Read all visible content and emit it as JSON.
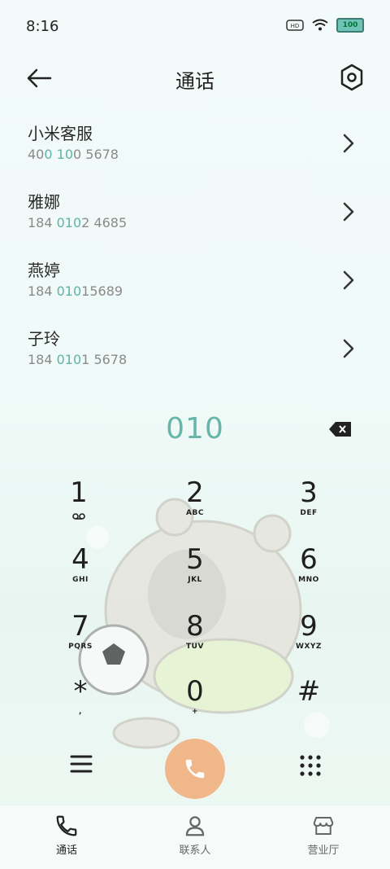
{
  "status": {
    "time": "8:16",
    "battery": "100"
  },
  "header": {
    "title": "通话"
  },
  "contacts": [
    {
      "name": "小米客服",
      "num_a": "40",
      "num_b": "0",
      "num_c": " ",
      "num_d": "10",
      "num_e": "0 5678"
    },
    {
      "name": "雅娜",
      "num_a": "184 ",
      "num_b": "010",
      "num_c": "",
      "num_d": "",
      "num_e": "2 4685"
    },
    {
      "name": "燕婷",
      "num_a": "184 ",
      "num_b": "010",
      "num_c": "",
      "num_d": "",
      "num_e": "15689"
    },
    {
      "name": "子玲",
      "num_a": "184 ",
      "num_b": "010",
      "num_c": "",
      "num_d": "",
      "num_e": "1 5678"
    }
  ],
  "dialer": {
    "input": "010"
  },
  "keys": [
    {
      "digit": "1",
      "letters": ""
    },
    {
      "digit": "2",
      "letters": "ABC"
    },
    {
      "digit": "3",
      "letters": "DEF"
    },
    {
      "digit": "4",
      "letters": "GHI"
    },
    {
      "digit": "5",
      "letters": "JKL"
    },
    {
      "digit": "6",
      "letters": "MNO"
    },
    {
      "digit": "7",
      "letters": "PQRS"
    },
    {
      "digit": "8",
      "letters": "TUV"
    },
    {
      "digit": "9",
      "letters": "WXYZ"
    },
    {
      "digit": "*",
      "letters": ","
    },
    {
      "digit": "0",
      "letters": "+"
    },
    {
      "digit": "#",
      "letters": ""
    }
  ],
  "nav": [
    {
      "label": "通话",
      "icon": "phone-icon"
    },
    {
      "label": "联系人",
      "icon": "person-icon"
    },
    {
      "label": "营业厅",
      "icon": "store-icon"
    }
  ],
  "colors": {
    "accent": "#5fb3a6",
    "call": "#f0b88a"
  }
}
